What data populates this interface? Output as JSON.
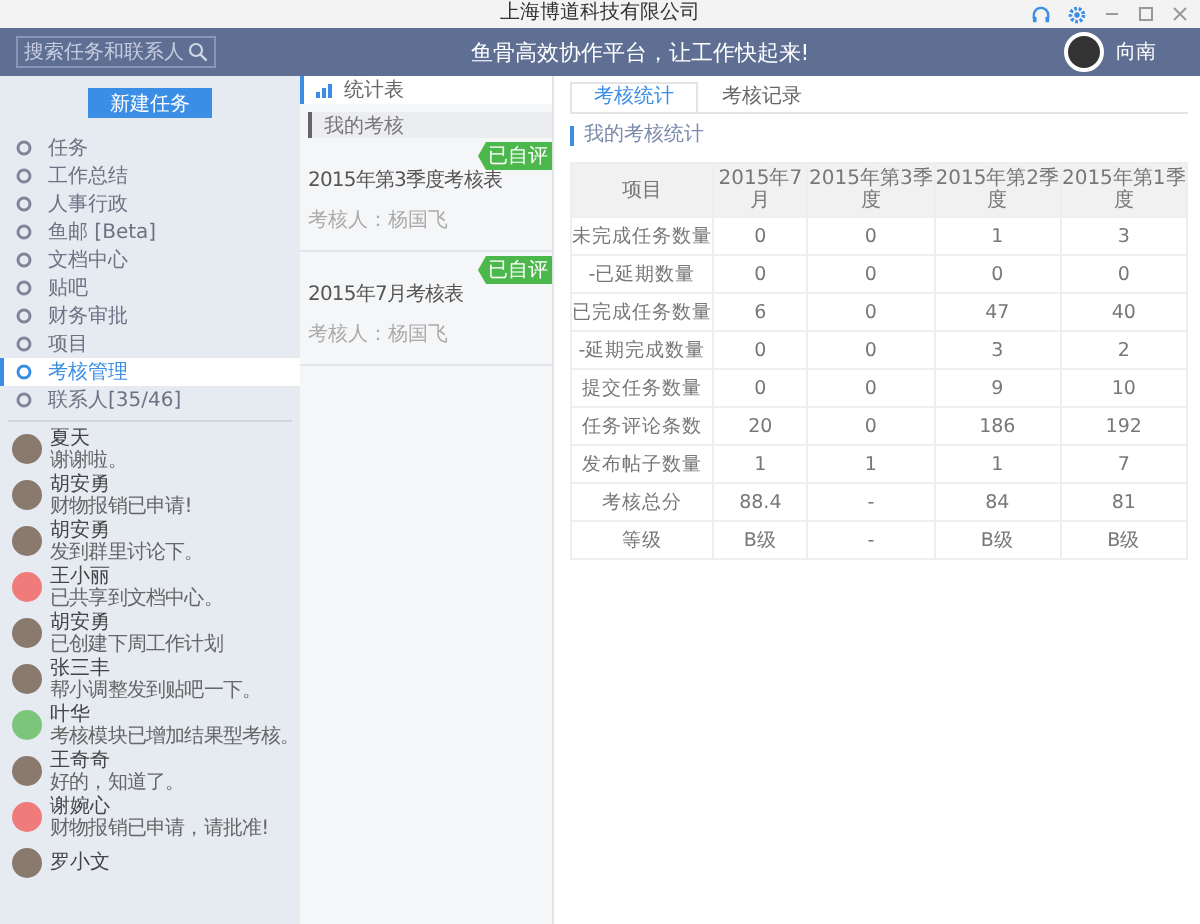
{
  "window": {
    "title": "上海博道科技有限公司"
  },
  "header": {
    "search": {
      "placeholder": "搜索任务和联系人"
    },
    "slogan": "鱼骨高效协作平台，让工作快起来!",
    "user": "向南"
  },
  "sidebar": {
    "new_button": "新建任务",
    "items": [
      {
        "label": "任务",
        "selected": false
      },
      {
        "label": "工作总结",
        "selected": false
      },
      {
        "label": "人事行政",
        "selected": false
      },
      {
        "label": "鱼邮 [Beta]",
        "selected": false
      },
      {
        "label": "文档中心",
        "selected": false
      },
      {
        "label": "贴吧",
        "selected": false
      },
      {
        "label": "财务审批",
        "selected": false
      },
      {
        "label": "项目",
        "selected": false
      },
      {
        "label": "考核管理",
        "selected": true
      },
      {
        "label": "联系人[35/46]",
        "selected": false
      }
    ],
    "contacts": [
      {
        "name": "夏天",
        "message": "谢谢啦。",
        "kind": "photo"
      },
      {
        "name": "胡安勇",
        "message": "财物报销已申请!",
        "kind": "photo"
      },
      {
        "name": "胡安勇",
        "message": "发到群里讨论下。",
        "kind": "photo"
      },
      {
        "name": "王小丽",
        "message": "已共享到文档中心。",
        "kind": "icon",
        "color": "#ef7b7b"
      },
      {
        "name": "胡安勇",
        "message": "已创建下周工作计划",
        "kind": "photo"
      },
      {
        "name": "张三丰",
        "message": "帮小调整发到贴吧一下。",
        "kind": "photo"
      },
      {
        "name": "叶华",
        "message": "考核模块已增加结果型考核。",
        "kind": "icon",
        "color": "#7cc67c"
      },
      {
        "name": "王奇奇",
        "message": "好的，知道了。",
        "kind": "photo"
      },
      {
        "name": "谢婉心",
        "message": "财物报销已申请，请批准!",
        "kind": "icon",
        "color": "#ef7b7b"
      },
      {
        "name": "罗小文",
        "kind": "photo"
      }
    ]
  },
  "middle": {
    "top_item": {
      "label": "统计表",
      "selected": true
    },
    "section": "我的考核",
    "cards": [
      {
        "title": "2015年第3季度考核表",
        "reviewer": "考核人：杨国飞",
        "badge": "已自评"
      },
      {
        "title": "2015年7月考核表",
        "reviewer": "考核人：杨国飞",
        "badge": "已自评"
      }
    ]
  },
  "tabs": [
    {
      "label": "考核统计",
      "selected": true
    },
    {
      "label": "考核记录",
      "selected": false
    }
  ],
  "stats": {
    "title": "我的考核统计",
    "columns": [
      "项目",
      "2015年7月",
      "2015年第3季度",
      "2015年第2季度",
      "2015年第1季度"
    ],
    "rows": [
      [
        "未完成任务数量",
        "0",
        "0",
        "1",
        "3"
      ],
      [
        "-已延期数量",
        "0",
        "0",
        "0",
        "0"
      ],
      [
        "已完成任务数量",
        "6",
        "0",
        "47",
        "40"
      ],
      [
        "-延期完成数量",
        "0",
        "0",
        "3",
        "2"
      ],
      [
        "提交任务数量",
        "0",
        "0",
        "9",
        "10"
      ],
      [
        "任务评论条数",
        "20",
        "0",
        "186",
        "192"
      ],
      [
        "发布帖子数量",
        "1",
        "1",
        "1",
        "7"
      ],
      [
        "考核总分",
        "88.4",
        "-",
        "84",
        "81"
      ],
      [
        "等级",
        "B级",
        "-",
        "B级",
        "B级"
      ]
    ]
  }
}
